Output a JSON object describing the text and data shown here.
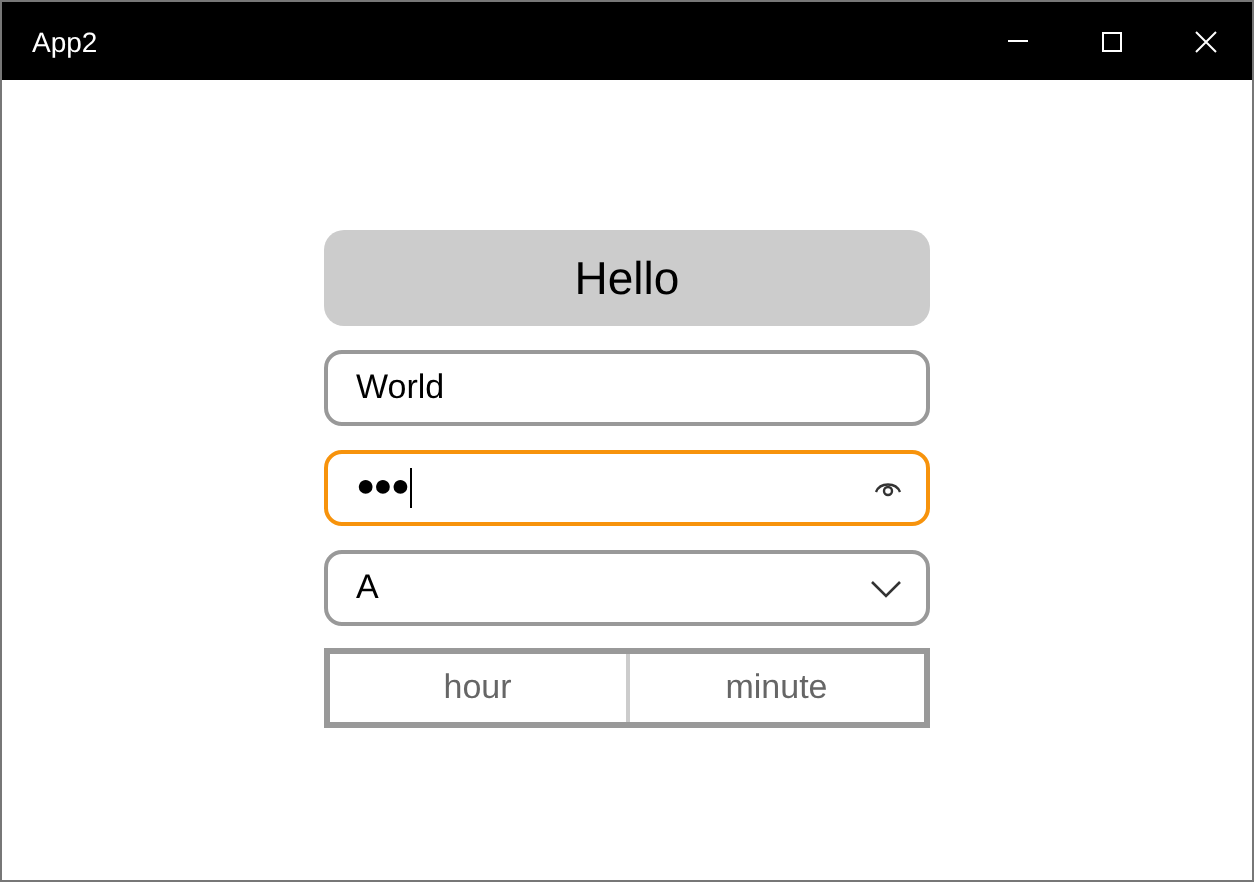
{
  "window": {
    "title": "App2"
  },
  "button": {
    "label": "Hello"
  },
  "text_field": {
    "value": "World"
  },
  "password_field": {
    "value": "●●●",
    "focused": true
  },
  "dropdown": {
    "value": "A"
  },
  "time_picker": {
    "parts": [
      "hour",
      "minute"
    ]
  }
}
